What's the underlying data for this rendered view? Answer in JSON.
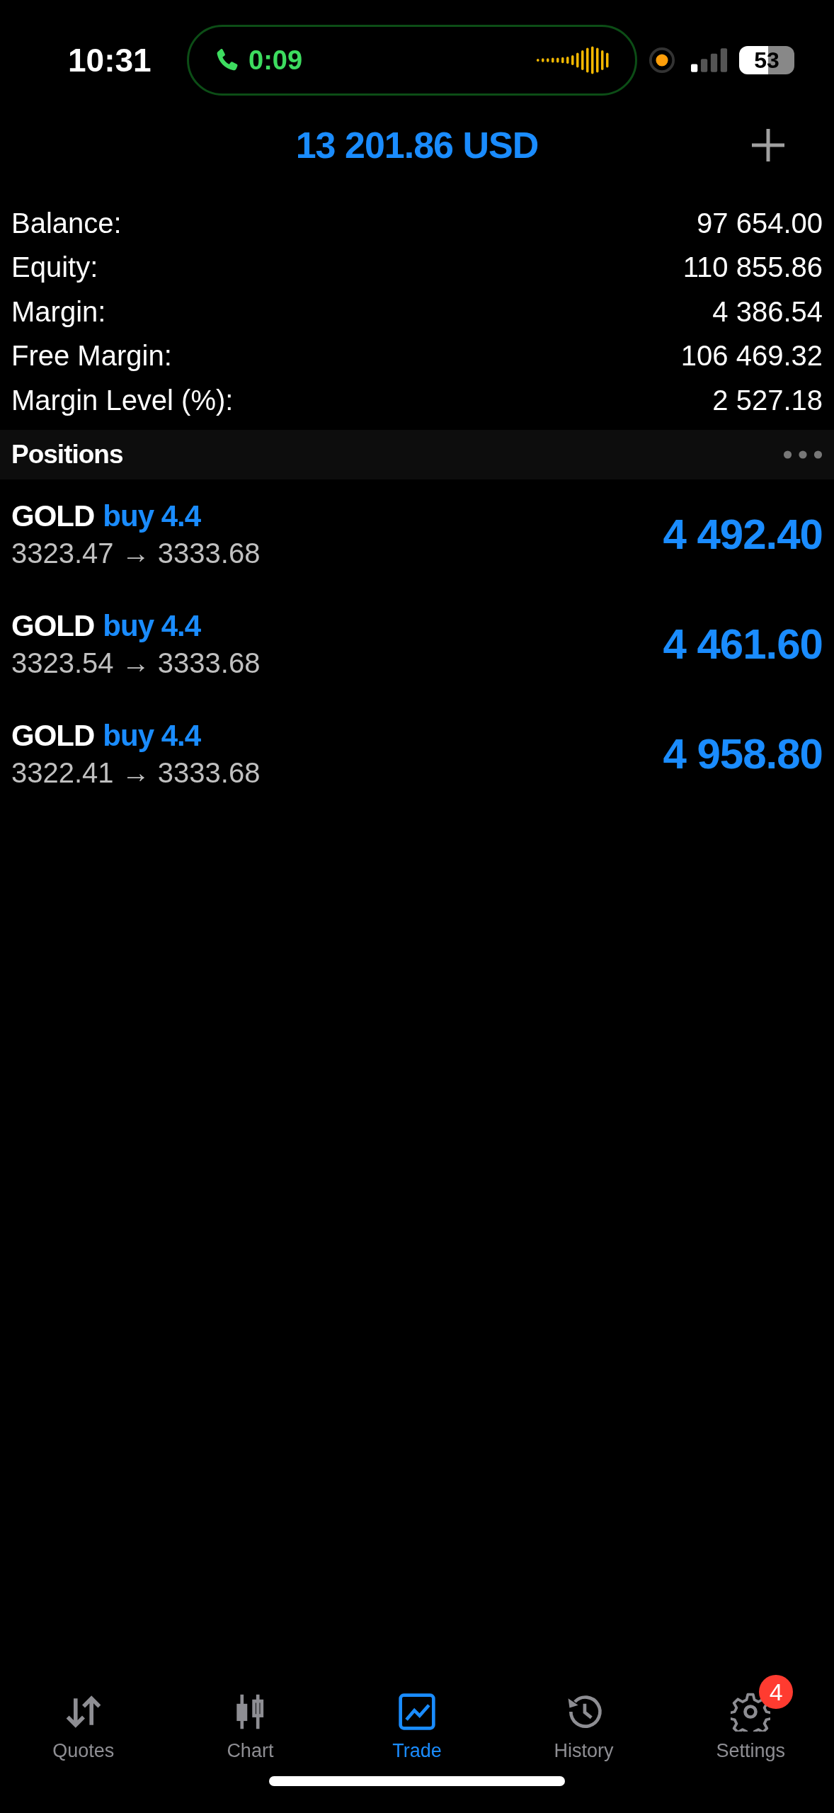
{
  "status_bar": {
    "time": "10:31",
    "call_timer": "0:09",
    "battery": "53"
  },
  "header": {
    "title": "13 201.86 USD"
  },
  "summary": [
    {
      "label": "Balance:",
      "value": "97 654.00"
    },
    {
      "label": "Equity:",
      "value": "110 855.86"
    },
    {
      "label": "Margin:",
      "value": "4 386.54"
    },
    {
      "label": "Free Margin:",
      "value": "106 469.32"
    },
    {
      "label": "Margin Level (%):",
      "value": "2 527.18"
    }
  ],
  "positions_header": {
    "title": "Positions"
  },
  "positions": [
    {
      "symbol": "GOLD",
      "side": "buy 4.4",
      "prices": "3323.47 → 3333.68",
      "profit": "4 492.40"
    },
    {
      "symbol": "GOLD",
      "side": "buy 4.4",
      "prices": "3323.54 → 3333.68",
      "profit": "4 461.60"
    },
    {
      "symbol": "GOLD",
      "side": "buy 4.4",
      "prices": "3322.41 → 3333.68",
      "profit": "4 958.80"
    }
  ],
  "tabs": [
    {
      "kind": "quotes",
      "label": "Quotes",
      "selected": false
    },
    {
      "kind": "chart",
      "label": "Chart",
      "selected": false
    },
    {
      "kind": "trade",
      "label": "Trade",
      "selected": true
    },
    {
      "kind": "history",
      "label": "History",
      "selected": false
    },
    {
      "kind": "settings",
      "label": "Settings",
      "selected": false,
      "badge": "4"
    }
  ]
}
